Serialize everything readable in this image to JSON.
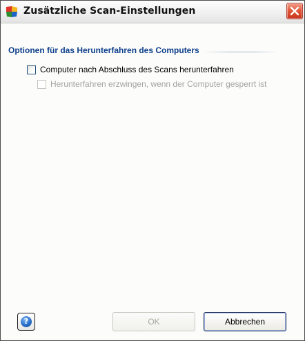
{
  "window": {
    "title": "Zusätzliche Scan-Einstellungen",
    "logo": "avg-logo-icon",
    "close_icon": "close-icon"
  },
  "section": {
    "title": "Optionen für das Herunterfahren des Computers"
  },
  "options": [
    {
      "label": "Computer nach Abschluss des Scans herunterfahren",
      "checked": false,
      "enabled": true
    },
    {
      "label": "Herunterfahren erzwingen, wenn der Computer gesperrt ist",
      "checked": false,
      "enabled": false
    }
  ],
  "footer": {
    "help_icon": "help-icon",
    "ok_label": "OK",
    "cancel_label": "Abbrechen"
  },
  "colors": {
    "section_title": "#0d3f8c",
    "close_button": "#d9462a",
    "disabled_text": "#a3a3a3"
  }
}
